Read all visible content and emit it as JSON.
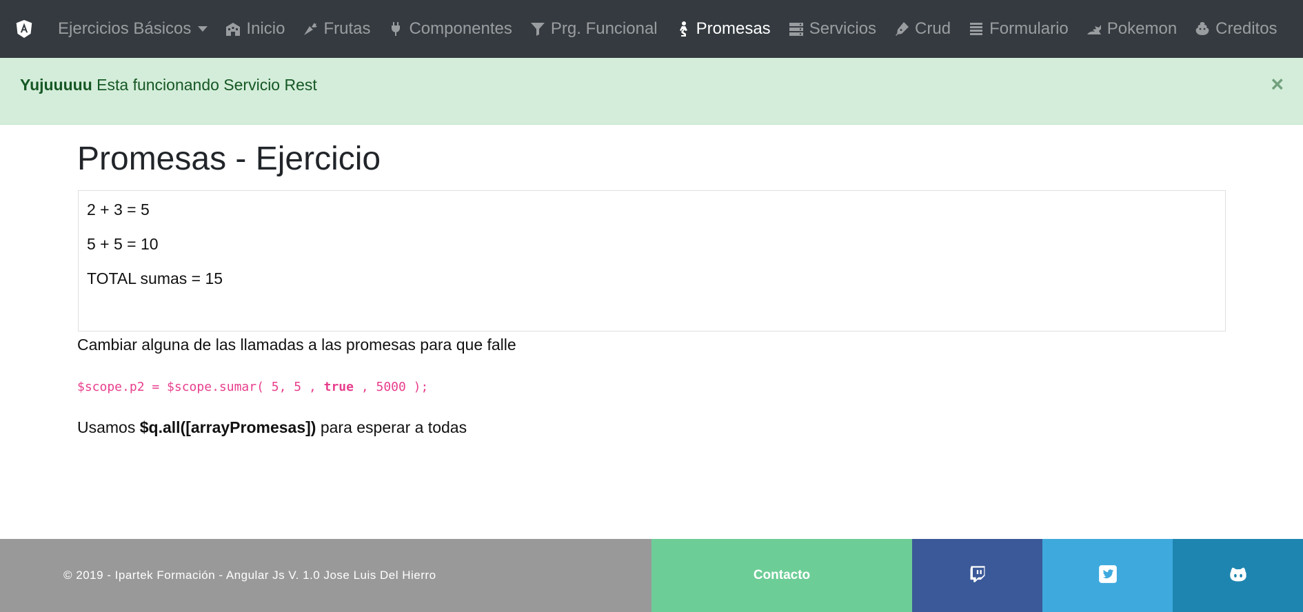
{
  "nav": {
    "items": [
      {
        "label": "Ejercicios Básicos",
        "icon": "caret-down-icon"
      },
      {
        "label": "Inicio",
        "icon": "building-icon"
      },
      {
        "label": "Frutas",
        "icon": "carrot-icon"
      },
      {
        "label": "Componentes",
        "icon": "plug-icon"
      },
      {
        "label": "Prg. Funcional",
        "icon": "filter-icon"
      },
      {
        "label": "Promesas",
        "icon": "praying-icon",
        "active": true
      },
      {
        "label": "Servicios",
        "icon": "server-icon"
      },
      {
        "label": "Crud",
        "icon": "pen-icon"
      },
      {
        "label": "Formulario",
        "icon": "list-icon"
      },
      {
        "label": "Pokemon",
        "icon": "dragon-icon"
      },
      {
        "label": "Creditos",
        "icon": "poo-icon"
      }
    ]
  },
  "alert": {
    "strong": "Yujuuuuu",
    "text": "Esta funcionando Servicio Rest",
    "close": "×"
  },
  "main": {
    "title": "Promesas - Ejercicio",
    "results": [
      "2 + 3 = 5",
      "5 + 5 = 10",
      "TOTAL sumas = 15"
    ],
    "instruction": "Cambiar alguna de las llamadas a las promesas para que falle",
    "code": {
      "pre": "$scope.p2 = $scope.sumar( 5, 5 , ",
      "keyword": "true",
      "post": " , 5000 );"
    },
    "usage": {
      "pre": "Usamos ",
      "strong": "$q.all([arrayPromesas])",
      "post": " para esperar a todas"
    }
  },
  "footer": {
    "copyright": "© 2019 - Ipartek Formación - Angular Js V. 1.0 Jose Luis Del Hierro",
    "contact": "Contacto",
    "social": [
      {
        "icon": "twitch-icon",
        "color": "#3b5998"
      },
      {
        "icon": "twitter-icon",
        "color": "#3ea9dd"
      },
      {
        "icon": "github-icon",
        "color": "#1e85b0"
      }
    ]
  },
  "colors": {
    "navbar": "#343a40",
    "alert_bg": "#d4edda",
    "alert_text": "#155724",
    "code": "#e83e8c",
    "footer_copy": "#999999",
    "footer_contact": "#6dcd97"
  }
}
